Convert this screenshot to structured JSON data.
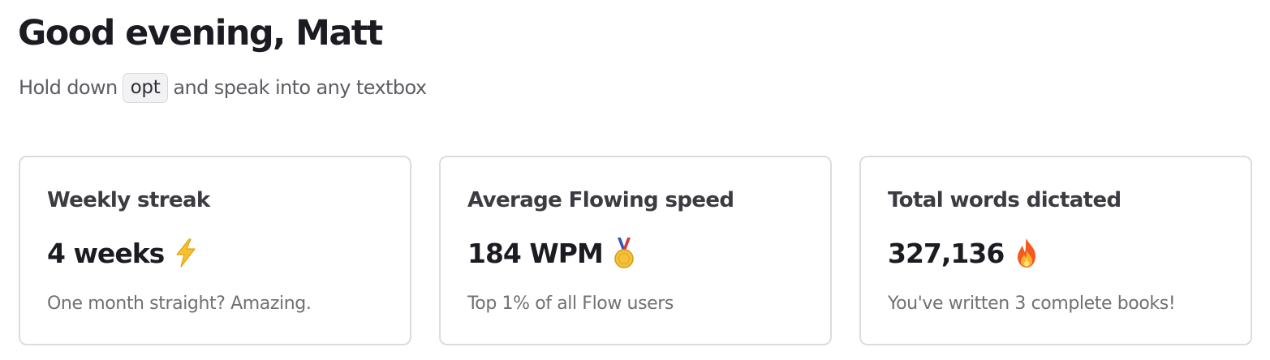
{
  "header": {
    "greeting": "Good evening, Matt",
    "hint_prefix": "Hold down",
    "hint_key": "opt",
    "hint_suffix": "and speak into any textbox"
  },
  "stats": [
    {
      "title": "Weekly streak",
      "value": "4 weeks",
      "icon": "lightning-icon",
      "caption": "One month straight? Amazing."
    },
    {
      "title": "Average Flowing speed",
      "value": "184 WPM",
      "icon": "medal-icon",
      "caption": "Top 1% of all Flow users"
    },
    {
      "title": "Total words dictated",
      "value": "327,136",
      "icon": "fire-icon",
      "caption": "You've written 3 complete books!"
    }
  ],
  "colors": {
    "text_primary": "#1b1b22",
    "text_secondary": "#707076",
    "card_border": "#dcdcdf",
    "key_background": "#f2f2f4"
  }
}
